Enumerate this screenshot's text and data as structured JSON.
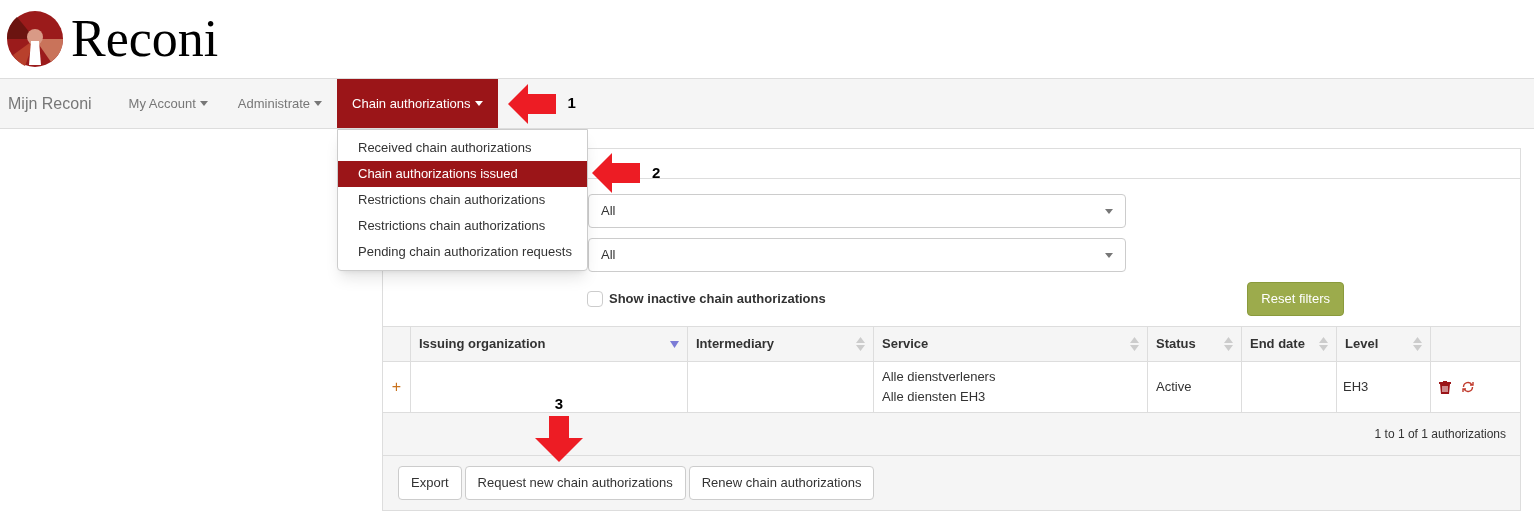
{
  "logo": {
    "text": "Reconi"
  },
  "nav": {
    "brand": "Mijn Reconi",
    "items": [
      {
        "label": "My Account",
        "selected": false
      },
      {
        "label": "Administrate",
        "selected": false
      },
      {
        "label": "Chain authorizations",
        "selected": true
      }
    ]
  },
  "dropdown": {
    "items": [
      {
        "label": "Received chain authorizations",
        "selected": false
      },
      {
        "label": "Chain authorizations issued",
        "selected": true
      },
      {
        "label": "Restrictions chain authorizations",
        "selected": false
      },
      {
        "label": "Restrictions chain authorizations",
        "selected": false
      },
      {
        "label": "Pending chain authorization requests",
        "selected": false
      }
    ]
  },
  "filters": {
    "selects": [
      {
        "value": "All"
      },
      {
        "value": "All"
      }
    ],
    "show_inactive": {
      "label": "Show inactive chain authorizations",
      "checked": false
    },
    "reset_button": "Reset filters"
  },
  "table": {
    "columns": [
      {
        "label": "Issuing organization",
        "kind": "sorted"
      },
      {
        "label": "Intermediary",
        "kind": "sortable"
      },
      {
        "label": "Service",
        "kind": "sortable"
      },
      {
        "label": "Status",
        "kind": "sortable"
      },
      {
        "label": "End date",
        "kind": "sortable"
      },
      {
        "label": "Level",
        "kind": "sortable"
      }
    ],
    "rows": [
      {
        "expand": "+",
        "issuing_organization": "",
        "intermediary": "",
        "service": [
          "Alle dienstverleners",
          "Alle diensten EH3"
        ],
        "status": "Active",
        "end_date": "",
        "level": "EH3"
      }
    ],
    "summary": "1 to 1 of 1 authorizations"
  },
  "buttons": [
    "Export",
    "Request new chain authorizations",
    "Renew chain authorizations"
  ],
  "callouts": [
    {
      "label": "1",
      "kind": "leftward"
    },
    {
      "label": "2",
      "kind": "leftward"
    },
    {
      "label": "3",
      "kind": "downward"
    }
  ]
}
